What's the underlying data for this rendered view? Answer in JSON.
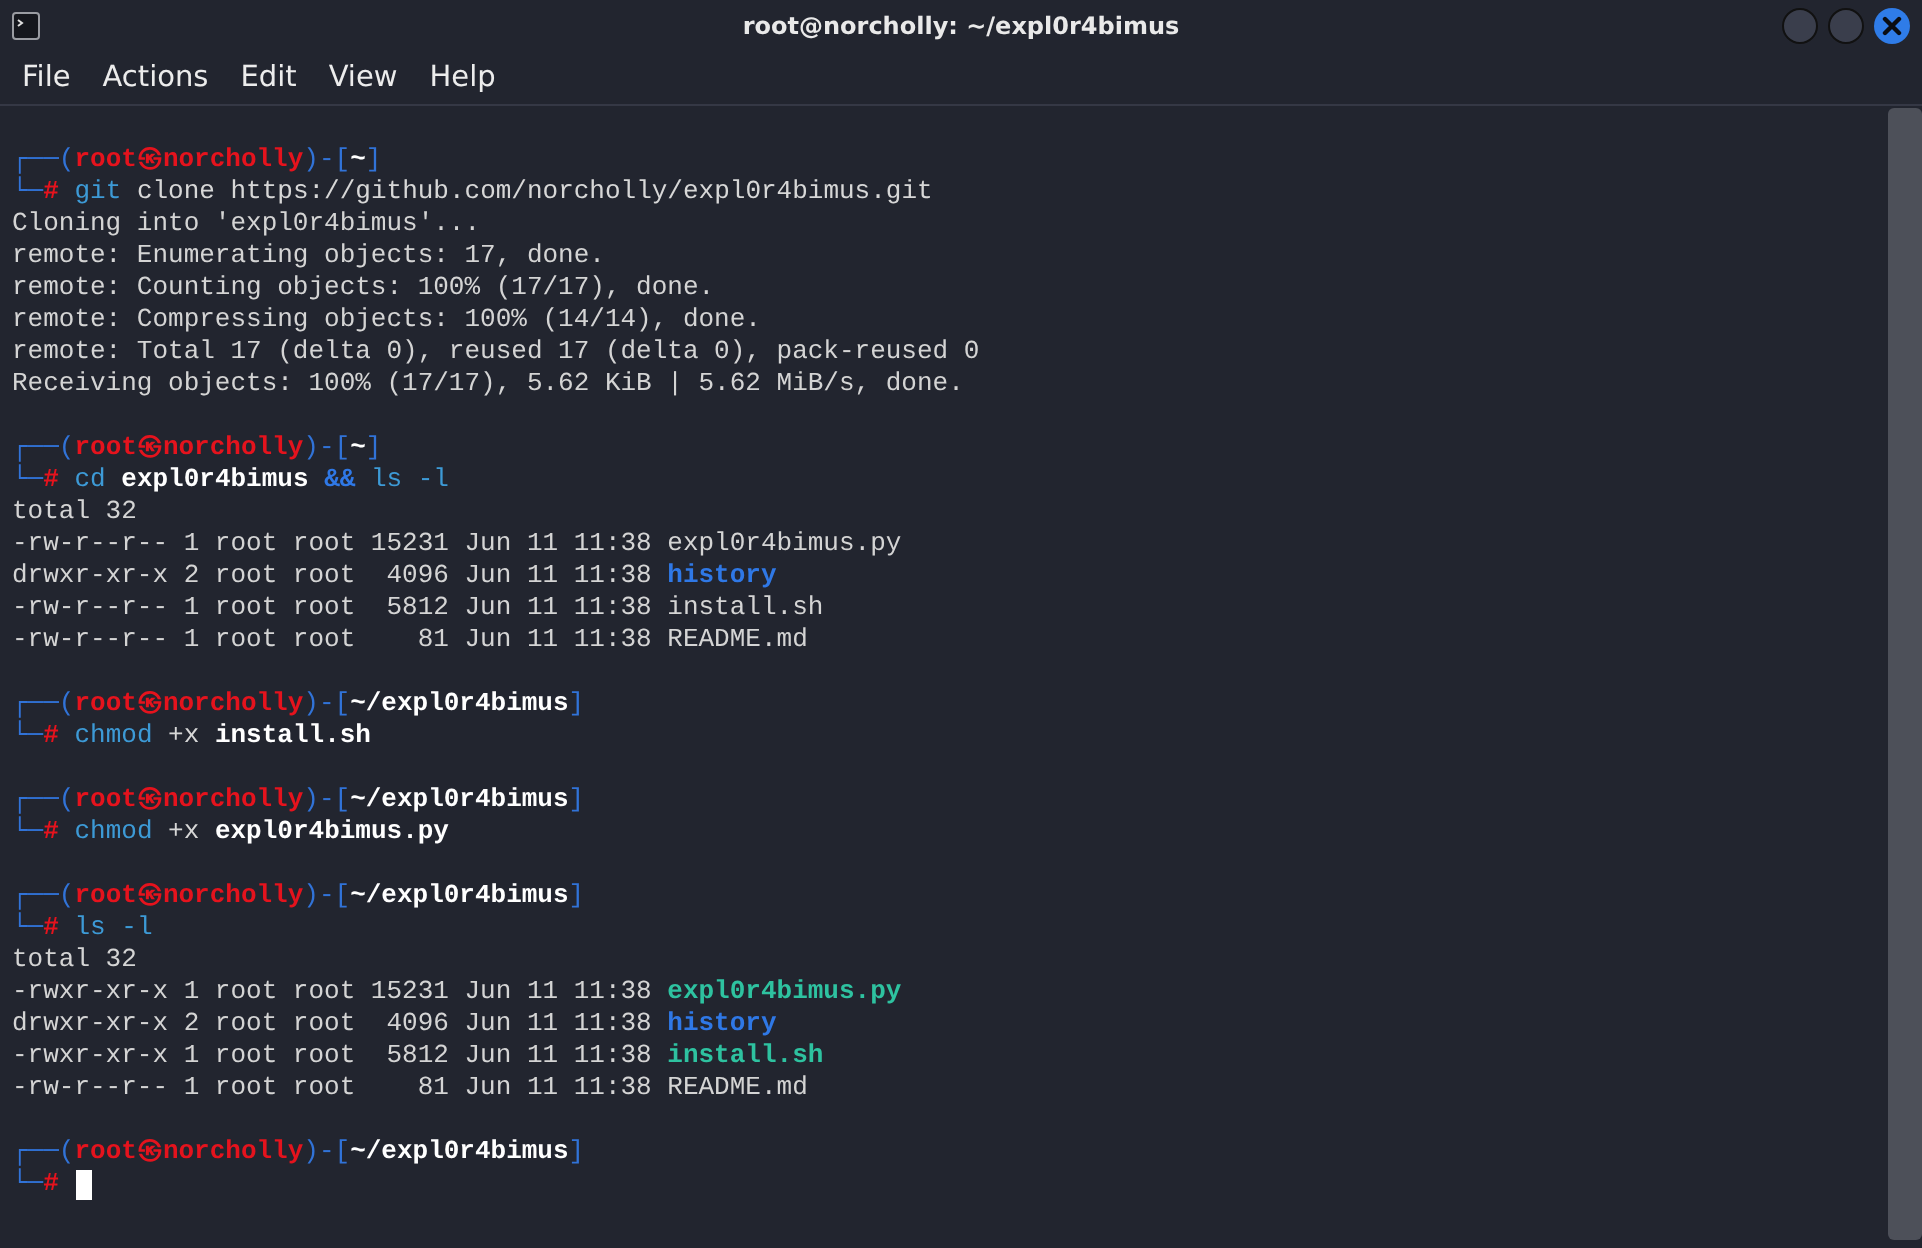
{
  "window": {
    "title": "root@norcholly: ~/expl0r4bimus",
    "menu": [
      "File",
      "Actions",
      "Edit",
      "View",
      "Help"
    ]
  },
  "terminal": {
    "blocks": [
      {
        "kind": "prompt",
        "frame_open": "┌──(",
        "user": "root",
        "at": "㉿",
        "host": "norcholly",
        "frame_mid": ")-[",
        "cwd": "~",
        "frame_close": "]",
        "corner": "└─",
        "symbol": "#",
        "command": [
          {
            "text": "git",
            "kind": "program"
          },
          {
            "text": " clone https://github.com/norcholly/expl0r4bimus.git",
            "kind": "argument"
          }
        ]
      },
      {
        "kind": "output",
        "segments": [
          {
            "text": "Cloning into 'expl0r4bimus'...",
            "kind": "text"
          }
        ]
      },
      {
        "kind": "output",
        "segments": [
          {
            "text": "remote: Enumerating objects: 17, done.",
            "kind": "text"
          }
        ]
      },
      {
        "kind": "output",
        "segments": [
          {
            "text": "remote: Counting objects: 100% (17/17), done.",
            "kind": "text"
          }
        ]
      },
      {
        "kind": "output",
        "segments": [
          {
            "text": "remote: Compressing objects: 100% (14/14), done.",
            "kind": "text"
          }
        ]
      },
      {
        "kind": "output",
        "segments": [
          {
            "text": "remote: Total 17 (delta 0), reused 17 (delta 0), pack-reused 0",
            "kind": "text"
          }
        ]
      },
      {
        "kind": "output",
        "segments": [
          {
            "text": "Receiving objects: 100% (17/17), 5.62 KiB | 5.62 MiB/s, done.",
            "kind": "text"
          }
        ]
      },
      {
        "kind": "blank"
      },
      {
        "kind": "prompt",
        "frame_open": "┌──(",
        "user": "root",
        "at": "㉿",
        "host": "norcholly",
        "frame_mid": ")-[",
        "cwd": "~",
        "frame_close": "]",
        "corner": "└─",
        "symbol": "#",
        "command": [
          {
            "text": "cd",
            "kind": "program"
          },
          {
            "text": " expl0r4bimus",
            "kind": "path"
          },
          {
            "text": " &&",
            "kind": "operator"
          },
          {
            "text": " ls -l",
            "kind": "program"
          }
        ]
      },
      {
        "kind": "output",
        "segments": [
          {
            "text": "total 32",
            "kind": "text"
          }
        ]
      },
      {
        "kind": "output",
        "segments": [
          {
            "text": "-rw-r--r-- 1 root root 15231 Jun 11 11:38 ",
            "kind": "text"
          },
          {
            "text": "expl0r4bimus.py",
            "kind": "text"
          }
        ]
      },
      {
        "kind": "output",
        "segments": [
          {
            "text": "drwxr-xr-x 2 root root  4096 Jun 11 11:38 ",
            "kind": "text"
          },
          {
            "text": "history",
            "kind": "directory"
          }
        ]
      },
      {
        "kind": "output",
        "segments": [
          {
            "text": "-rw-r--r-- 1 root root  5812 Jun 11 11:38 ",
            "kind": "text"
          },
          {
            "text": "install.sh",
            "kind": "text"
          }
        ]
      },
      {
        "kind": "output",
        "segments": [
          {
            "text": "-rw-r--r-- 1 root root    81 Jun 11 11:38 ",
            "kind": "text"
          },
          {
            "text": "README.md",
            "kind": "text"
          }
        ]
      },
      {
        "kind": "blank"
      },
      {
        "kind": "prompt",
        "frame_open": "┌──(",
        "user": "root",
        "at": "㉿",
        "host": "norcholly",
        "frame_mid": ")-[",
        "cwd": "~/expl0r4bimus",
        "frame_close": "]",
        "corner": "└─",
        "symbol": "#",
        "command": [
          {
            "text": "chmod",
            "kind": "program"
          },
          {
            "text": " +x",
            "kind": "argument"
          },
          {
            "text": " install.sh",
            "kind": "path"
          }
        ]
      },
      {
        "kind": "blank"
      },
      {
        "kind": "prompt",
        "frame_open": "┌──(",
        "user": "root",
        "at": "㉿",
        "host": "norcholly",
        "frame_mid": ")-[",
        "cwd": "~/expl0r4bimus",
        "frame_close": "]",
        "corner": "└─",
        "symbol": "#",
        "command": [
          {
            "text": "chmod",
            "kind": "program"
          },
          {
            "text": " +x",
            "kind": "argument"
          },
          {
            "text": " expl0r4bimus.py",
            "kind": "path"
          }
        ]
      },
      {
        "kind": "blank"
      },
      {
        "kind": "prompt",
        "frame_open": "┌──(",
        "user": "root",
        "at": "㉿",
        "host": "norcholly",
        "frame_mid": ")-[",
        "cwd": "~/expl0r4bimus",
        "frame_close": "]",
        "corner": "└─",
        "symbol": "#",
        "command": [
          {
            "text": "ls -l",
            "kind": "program"
          }
        ]
      },
      {
        "kind": "output",
        "segments": [
          {
            "text": "total 32",
            "kind": "text"
          }
        ]
      },
      {
        "kind": "output",
        "segments": [
          {
            "text": "-rwxr-xr-x 1 root root 15231 Jun 11 11:38 ",
            "kind": "text"
          },
          {
            "text": "expl0r4bimus.py",
            "kind": "executable"
          }
        ]
      },
      {
        "kind": "output",
        "segments": [
          {
            "text": "drwxr-xr-x 2 root root  4096 Jun 11 11:38 ",
            "kind": "text"
          },
          {
            "text": "history",
            "kind": "directory"
          }
        ]
      },
      {
        "kind": "output",
        "segments": [
          {
            "text": "-rwxr-xr-x 1 root root  5812 Jun 11 11:38 ",
            "kind": "text"
          },
          {
            "text": "install.sh",
            "kind": "executable"
          }
        ]
      },
      {
        "kind": "output",
        "segments": [
          {
            "text": "-rw-r--r-- 1 root root    81 Jun 11 11:38 ",
            "kind": "text"
          },
          {
            "text": "README.md",
            "kind": "text"
          }
        ]
      },
      {
        "kind": "blank"
      },
      {
        "kind": "prompt",
        "frame_open": "┌──(",
        "user": "root",
        "at": "㉿",
        "host": "norcholly",
        "frame_mid": ")-[",
        "cwd": "~/expl0r4bimus",
        "frame_close": "]",
        "corner": "└─",
        "symbol": "#"
      }
    ]
  }
}
